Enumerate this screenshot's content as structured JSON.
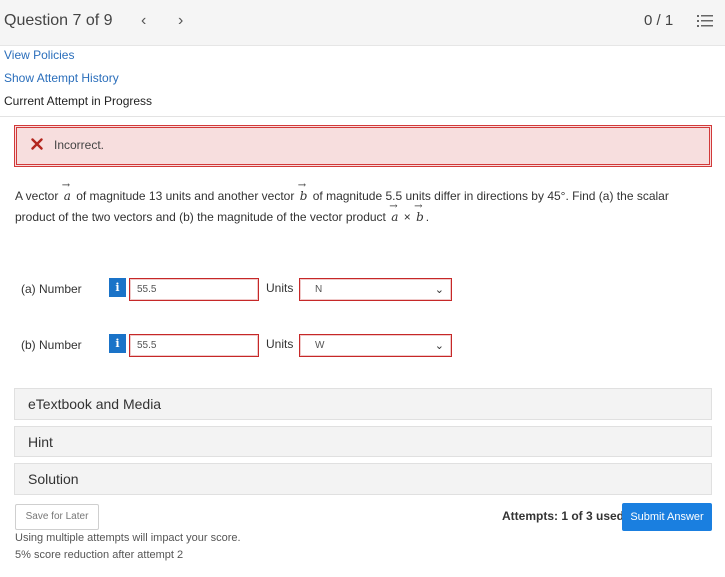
{
  "header": {
    "question_label": "Question 7 of 9",
    "prev_arrow": "‹",
    "next_arrow": "›",
    "score": "0 / 1",
    "list_icon": "list-icon"
  },
  "links": {
    "view_policies": "View Policies",
    "show_attempt_history": "Show Attempt History"
  },
  "attempt_status": "Current Attempt in Progress",
  "feedback": {
    "text": "Incorrect.",
    "icon": "close-icon",
    "color": "#d23939"
  },
  "question": {
    "part1": "A vector",
    "vec_a": "a",
    "part2": "of magnitude 13 units and another vector",
    "vec_b": "b",
    "part3": "of magnitude 5.5 units differ in directions by 45°. Find (a) the scalar product of the two vectors and (b) the magnitude of the vector product",
    "times": "×",
    "end": "."
  },
  "answers": [
    {
      "label": "(a)   Number",
      "info": "i",
      "value": "55.5",
      "units_label": "Units",
      "unit": "N"
    },
    {
      "label": "(b)   Number",
      "info": "i",
      "value": "55.5",
      "units_label": "Units",
      "unit": "W"
    }
  ],
  "panels": {
    "etextbook": "eTextbook and Media",
    "hint": "Hint",
    "solution": "Solution"
  },
  "footer": {
    "save_label": "Save for Later",
    "attempts_text": "Attempts: 1 of 3 used",
    "submit_label": "Submit Answer",
    "note1": "Using multiple attempts will impact your score.",
    "note2": "5% score reduction after attempt 2"
  },
  "colors": {
    "accent": "#1a7fe0",
    "error": "#d23939"
  }
}
